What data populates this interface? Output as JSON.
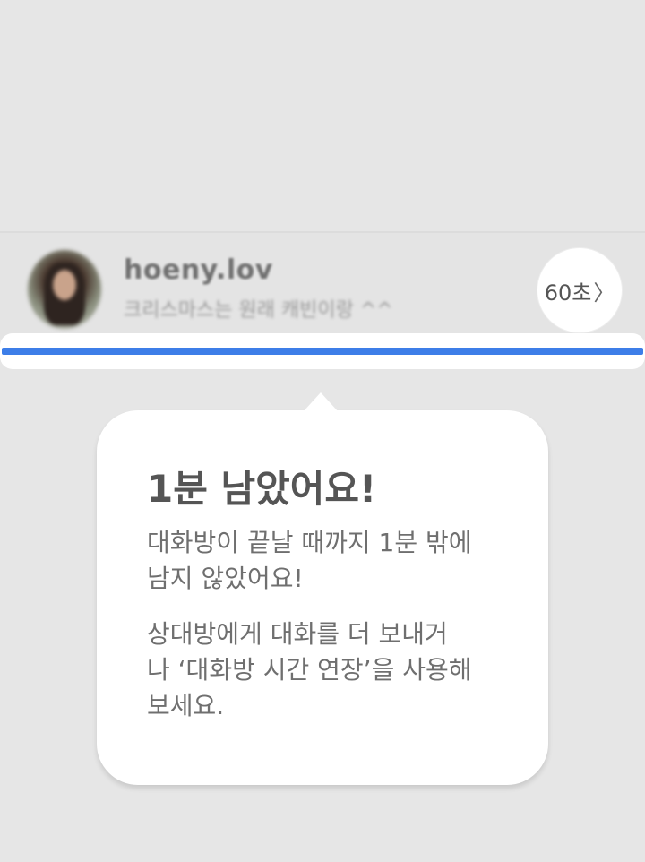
{
  "chat_item": {
    "username": "hoeny.lov",
    "last_message": "크리스마스는 원래 캐빈이랑 ^^",
    "avatar_icon": "profile-photo",
    "timer_label": "60초",
    "timer_chevron": "〉",
    "progress_fraction": 1.0,
    "progress_color": "#3d7ee8"
  },
  "tooltip": {
    "title": "1분 남았어요!",
    "paragraph1_line1": "대화방이 끝날 때까지 1분 밖에",
    "paragraph1_line2": "남지 않았어요!",
    "paragraph2_line1": "상대방에게 대화를 더 보내거",
    "paragraph2_line2": "나 ‘대화방 시간 연장’을 사용해",
    "paragraph2_line3": "보세요."
  }
}
